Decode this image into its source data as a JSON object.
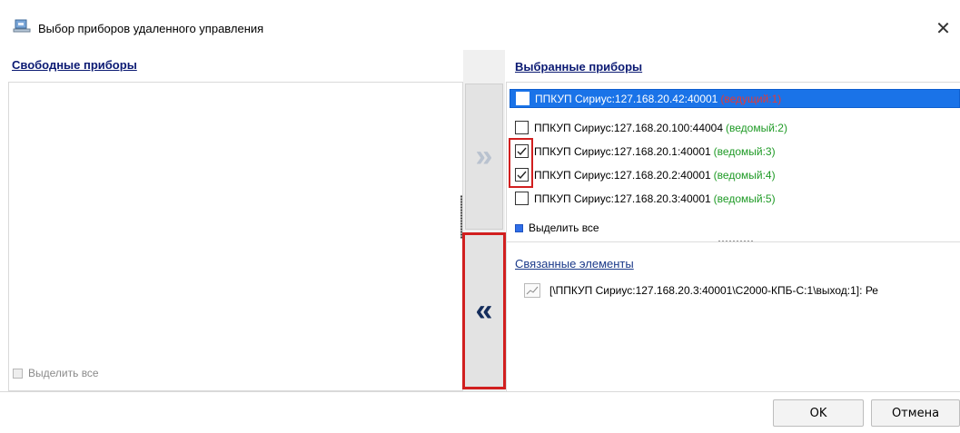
{
  "window": {
    "title": "Выбор приборов удаленного управления",
    "close_glyph": "✕"
  },
  "left_panel": {
    "title": "Свободные приборы",
    "select_all": "Выделить все"
  },
  "center": {
    "add_glyph": "»",
    "remove_glyph": "«"
  },
  "right_panel": {
    "title": "Выбранные приборы",
    "devices": [
      {
        "name": "ППКУП Сириус:127.168.20.42:40001",
        "status": "(ведущий:1)",
        "status_color": "#e53935",
        "checked": false,
        "selected": true
      },
      {
        "name": "ППКУП Сириус:127.168.20.100:44004",
        "status": "(ведомый:2)",
        "status_color": "#1e9a25",
        "checked": false,
        "selected": false
      },
      {
        "name": "ППКУП Сириус:127.168.20.1:40001",
        "status": "(ведомый:3)",
        "status_color": "#1e9a25",
        "checked": true,
        "selected": false
      },
      {
        "name": "ППКУП Сириус:127.168.20.2:40001",
        "status": "(ведомый:4)",
        "status_color": "#1e9a25",
        "checked": true,
        "selected": false
      },
      {
        "name": "ППКУП Сириус:127.168.20.3:40001",
        "status": "(ведомый:5)",
        "status_color": "#1e9a25",
        "checked": false,
        "selected": false
      }
    ],
    "select_all": "Выделить все",
    "linked_title": "Связанные элементы",
    "linked_items": [
      "[\\ППКУП Сириус:127.168.20.3:40001\\С2000-КПБ-С:1\\выход:1]: Ре"
    ]
  },
  "footer": {
    "ok": "OK",
    "cancel": "Отмена"
  },
  "colors": {
    "accent_blue": "#1a73e8",
    "highlight_red": "#d11f1f",
    "link_dark": "#0b1a73"
  },
  "icons": {
    "title": "devices-icon",
    "linked": "chart-line-icon"
  }
}
